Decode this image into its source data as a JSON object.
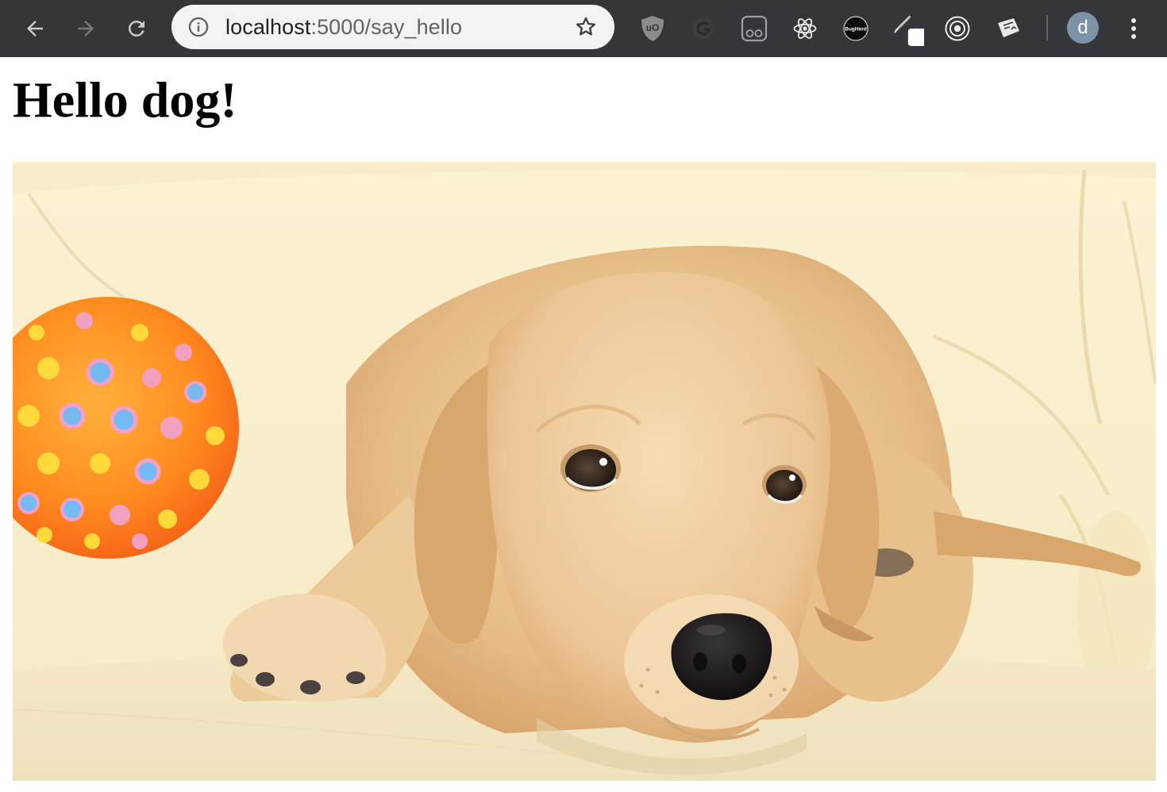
{
  "browser": {
    "url_host": "localhost",
    "url_rest": ":5000/say_hello",
    "icons": {
      "back": "back-arrow-icon",
      "forward": "forward-arrow-icon",
      "reload": "reload-icon",
      "site_info": "info-icon",
      "bookmark": "star-icon",
      "menu": "vertical-dots-icon"
    },
    "extensions": [
      {
        "name": "ublock-origin-icon",
        "badge": "uO"
      },
      {
        "name": "grammarly-icon"
      },
      {
        "name": "pair-browsing-icon"
      },
      {
        "name": "react-devtools-icon"
      },
      {
        "name": "bugherd-icon",
        "badge": "BugHerd"
      },
      {
        "name": "pen-tool-icon"
      },
      {
        "name": "target-icon"
      },
      {
        "name": "snippet-icon"
      }
    ],
    "profile_initial": "d",
    "colors": {
      "toolbar": "#35363a",
      "omnibox": "#f1f3f4",
      "avatar": "#7c93a8"
    }
  },
  "page": {
    "title": "Hello dog!",
    "image_alt": "puppy lying on a cream sofa next to an orange spiky ball"
  }
}
